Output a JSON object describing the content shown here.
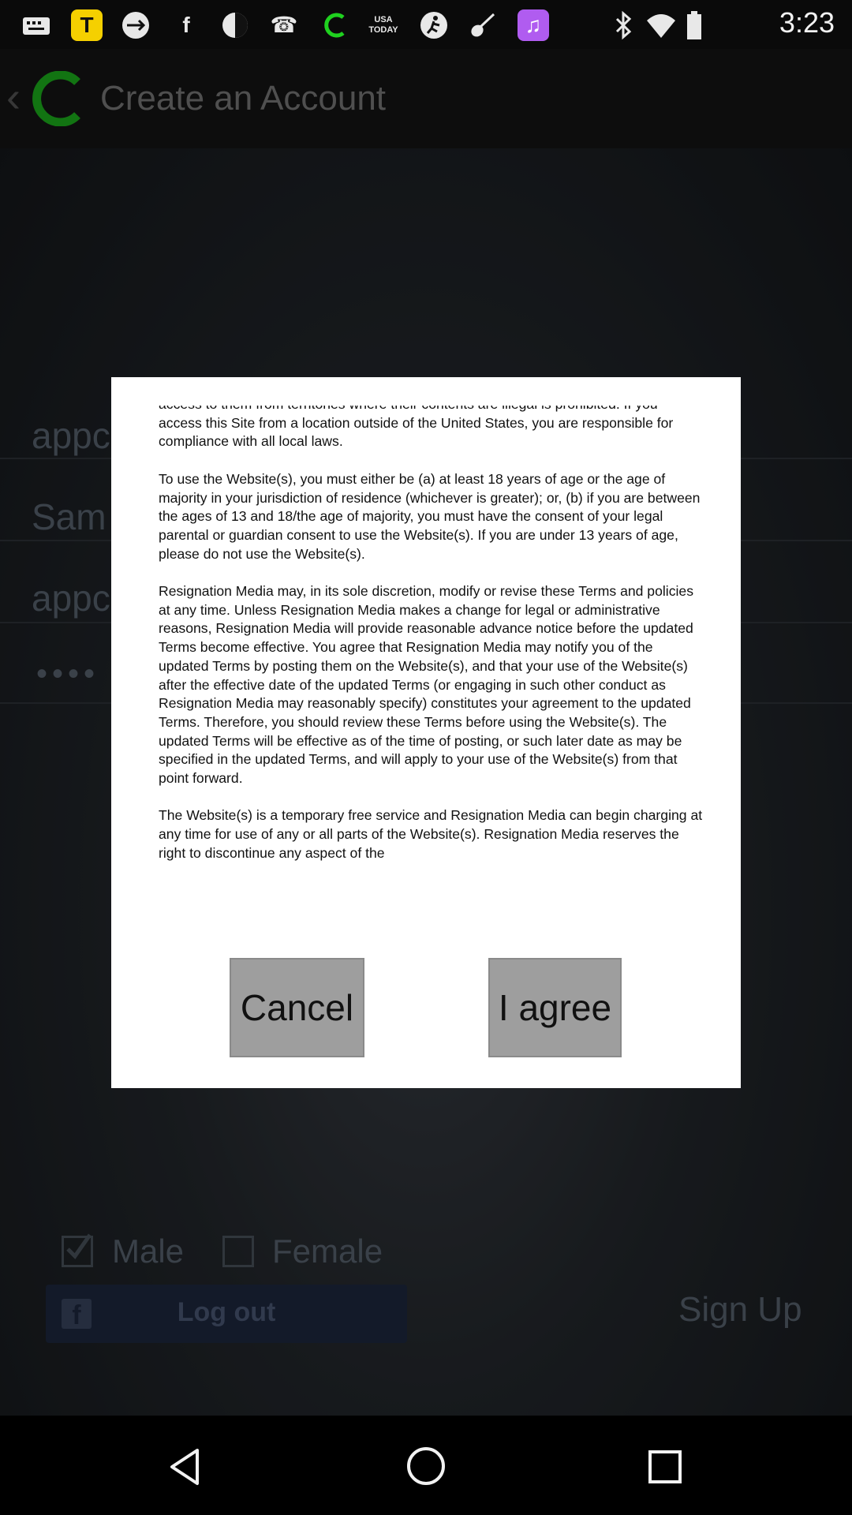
{
  "status_bar": {
    "icons": [
      "notifications-icon",
      "t-app-icon",
      "usb-icon",
      "facebook-icon",
      "theme-icon",
      "phone-icon",
      "c-app-icon",
      "usa-today-icon",
      "soccer-icon",
      "guitar-icon",
      "music-icon",
      "bluetooth-icon",
      "wifi-icon",
      "battery-icon"
    ],
    "time": "3:23"
  },
  "app_bar": {
    "title": "Create an Account"
  },
  "form_background": {
    "field1": "appc",
    "field2": "Sam",
    "field3": "appc",
    "password_dots": "••••",
    "male_label": "Male",
    "female_label": "Female",
    "male_checked": true,
    "female_checked": false,
    "facebook_button": "Log out",
    "signup_label": "Sign Up"
  },
  "dialog": {
    "paragraphs": [
      "access to them from territories where their contents are illegal is prohibited. If you access this Site from a location outside of the United States, you are responsible for compliance with all local laws.",
      "To use the Website(s), you must either be (a) at least 18 years of age or the age of majority in your jurisdiction of residence (whichever is greater); or, (b) if you are between the ages of 13 and 18/the age of majority, you must have the consent of your legal parental or guardian consent to use the Website(s). If you are under 13 years of age, please do not use the Website(s).",
      "Resignation Media may, in its sole discretion, modify or revise these Terms and policies at any time. Unless Resignation Media makes a change for legal or administrative reasons, Resignation Media will provide reasonable advance notice before the updated Terms become effective. You agree that Resignation Media may notify you of the updated Terms by posting them on the Website(s), and that your use of the Website(s) after the effective date of the updated Terms (or engaging in such other conduct as Resignation Media may reasonably specify) constitutes your agreement to the updated Terms. Therefore, you should review these Terms before using the Website(s). The updated Terms will be effective as of the time of posting, or such later date as may be specified in the updated Terms, and will apply to your use of the Website(s) from that point forward.",
      "The Website(s) is a temporary free service and Resignation Media can begin charging at any time for use of any or all parts of the Website(s). Resignation Media reserves the right to discontinue any aspect of the"
    ],
    "cancel_label": "Cancel",
    "agree_label": "I agree"
  }
}
